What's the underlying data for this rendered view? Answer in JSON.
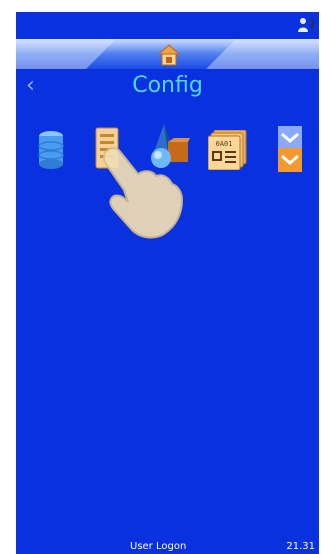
{
  "header": {
    "title": "Config",
    "home_icon": "home-icon",
    "back_icon": "chevron-left-icon",
    "back_glyph": "‹",
    "user_icon": "user-music-icon"
  },
  "toolbar": {
    "items": [
      {
        "name": "database-icon"
      },
      {
        "name": "document-settings-icon"
      },
      {
        "name": "shapes-icon"
      },
      {
        "name": "barcode-labels-icon",
        "label": "0A01"
      },
      {
        "name": "scroll-down-icon"
      }
    ]
  },
  "overlay": {
    "icon": "pointing-hand-icon"
  },
  "footer": {
    "user_logon": "User Logon",
    "time": "21.31"
  },
  "colors": {
    "background": "#0a31e0",
    "title": "#4fd8ff",
    "footer_text": "#ffffff"
  }
}
